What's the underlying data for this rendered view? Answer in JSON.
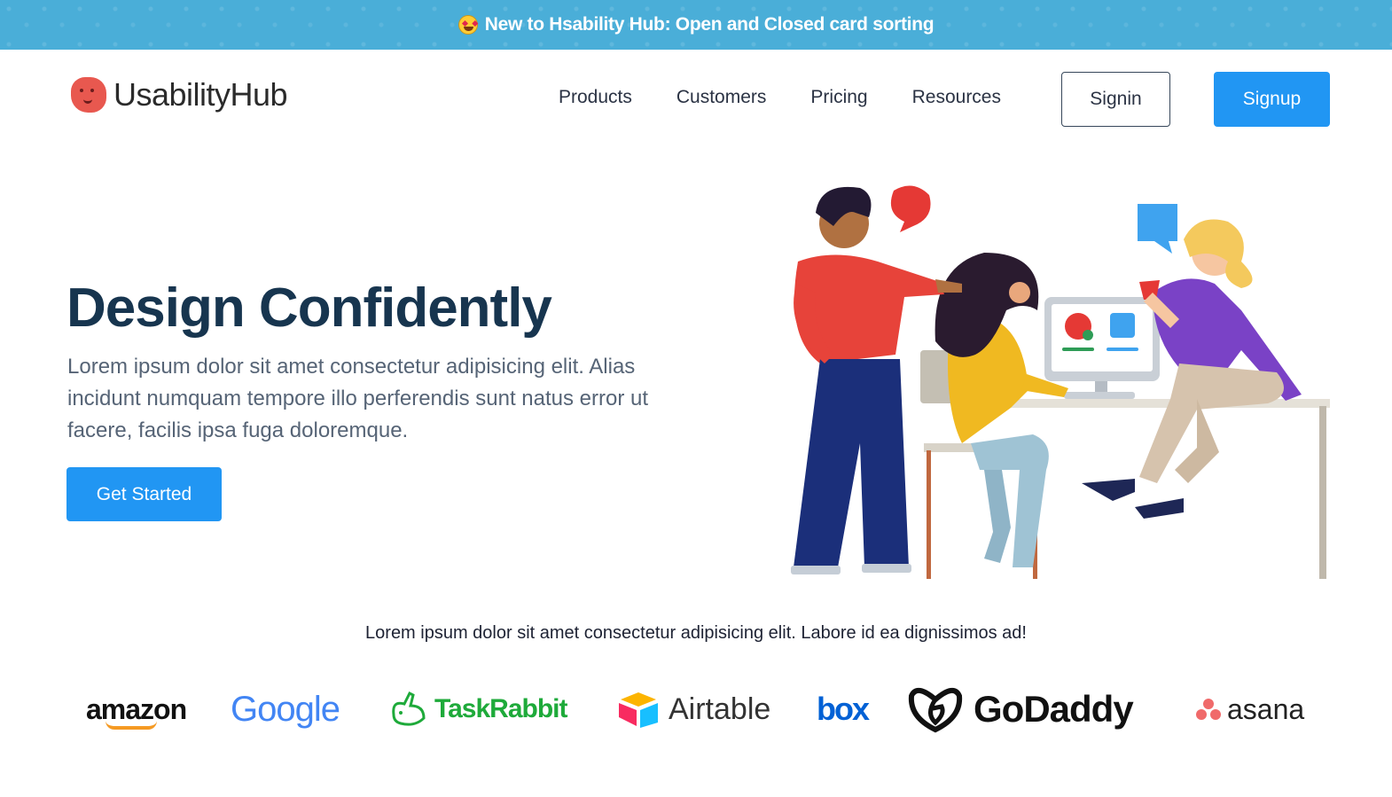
{
  "announcement": {
    "text": "New to Hsability Hub: Open and Closed card sorting",
    "icon": "star-struck-emoji"
  },
  "brand": {
    "name": "UsabilityHub",
    "logo_icon": "usabilityhub-logo-icon"
  },
  "nav": {
    "items": [
      "Products",
      "Customers",
      "Pricing",
      "Resources"
    ],
    "signin_label": "Signin",
    "signup_label": "Signup"
  },
  "hero": {
    "title": "Design Confidently",
    "text": "Lorem ipsum dolor sit amet consectetur adipisicing elit. Alias incidunt numquam tempore illo perferendis sunt natus error ut facere, facilis ipsa fuga doloremque.",
    "cta_label": "Get Started",
    "illustration": "team-working-at-computer-illustration"
  },
  "customers": {
    "tagline": "Lorem ipsum dolor sit amet consectetur adipisicing elit. Labore id ea dignissimos ad!",
    "logos": [
      "amazon",
      "Google",
      "TaskRabbit",
      "Airtable",
      "box",
      "GoDaddy",
      "asana"
    ]
  },
  "colors": {
    "accent": "#2196f3",
    "banner": "#4aaed8",
    "heading": "#17354f"
  }
}
